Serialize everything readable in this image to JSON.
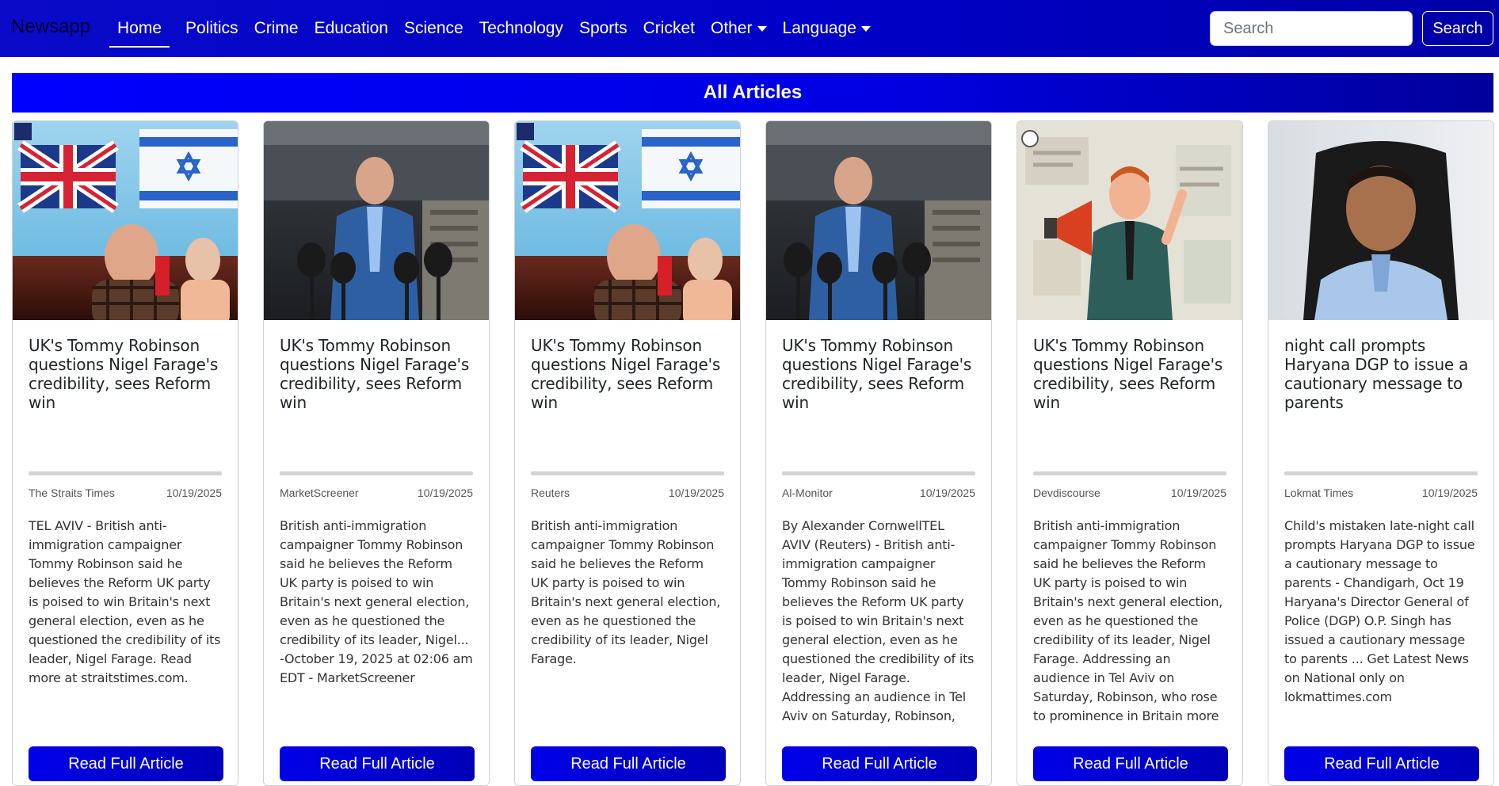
{
  "nav": {
    "brand": "Newsapp",
    "links": [
      {
        "label": "Home"
      },
      {
        "label": "Politics"
      },
      {
        "label": "Crime"
      },
      {
        "label": "Education"
      },
      {
        "label": "Science"
      },
      {
        "label": "Technology"
      },
      {
        "label": "Sports"
      },
      {
        "label": "Cricket"
      },
      {
        "label": "Other"
      },
      {
        "label": "Language"
      }
    ],
    "search_placeholder": "Search",
    "search_button": "Search"
  },
  "section_title": "All Articles",
  "read_label": "Read Full Article",
  "articles": [
    {
      "title": "UK's Tommy Robinson questions Nigel Farage's credibility, sees Reform win",
      "source": "The Straits Times",
      "date": "10/19/2025",
      "description": "TEL AVIV - British anti-immigration campaigner Tommy Robinson said he believes the Reform UK party is poised to win Britain's next general election, even as he questioned the credibility of its leader, Nigel Farage. Read more at straitstimes.com.",
      "image": "flags-speaker-photo"
    },
    {
      "title": "UK's Tommy Robinson questions Nigel Farage's credibility, sees Reform win",
      "source": "MarketScreener",
      "date": "10/19/2025",
      "description": "British anti-immigration campaigner Tommy Robinson said he believes the Reform UK party is poised to win Britain's next general election, even as he questioned the credibility of its leader, Nigel... -October 19, 2025 at 02:06 am EDT - MarketScreener",
      "image": "crown-court-press-photo"
    },
    {
      "title": "UK's Tommy Robinson questions Nigel Farage's credibility, sees Reform win",
      "source": "Reuters",
      "date": "10/19/2025",
      "description": "British anti-immigration campaigner Tommy Robinson said he believes the Reform UK party is poised to win Britain's next general election, even as he questioned the credibility of its leader, Nigel Farage.",
      "image": "flags-speaker-photo"
    },
    {
      "title": "UK's Tommy Robinson questions Nigel Farage's credibility, sees Reform win",
      "source": "Al-Monitor",
      "date": "10/19/2025",
      "description": "By Alexander CornwellTEL AVIV (Reuters) - British anti-immigration campaigner Tommy Robinson said he believes the Reform UK party is poised to win Britain's next general election, even as he questioned the credibility of its leader, Nigel Farage. Addressing an audience in Tel Aviv on Saturday, Robinson, who rose to prominence in Britain more than a decade ago by organising protests",
      "image": "crown-court-press-photo"
    },
    {
      "title": "UK's Tommy Robinson questions Nigel Farage's credibility, sees Reform win",
      "source": "Devdiscourse",
      "date": "10/19/2025",
      "description": "British anti-immigration campaigner Tommy Robinson said he believes the Reform UK party is poised to win Britain's next general election, even as he questioned the credibility of its leader, Nigel Farage. Addressing an audience in Tel Aviv on Saturday, Robinson, who rose to prominence in Britain more than a decade ago by organising protests",
      "image": "megaphone-illustration"
    },
    {
      "title": "night call prompts Haryana DGP to issue a cautionary message to parents",
      "source": "Lokmat Times",
      "date": "10/19/2025",
      "description": "Child's mistaken late-night call prompts Haryana DGP to issue a cautionary message to parents - Chandigarh, Oct 19 Haryana's Director General of Police (DGP) O.P. Singh has issued a cautionary message to parents ... Get Latest News on National only on lokmattimes.com",
      "image": "official-portrait-photo"
    }
  ]
}
